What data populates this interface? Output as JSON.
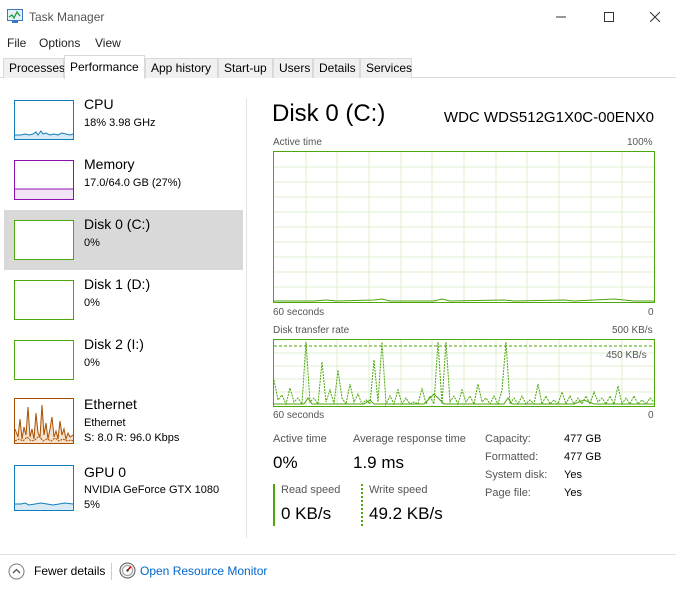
{
  "window": {
    "title": "Task Manager"
  },
  "menu": [
    "File",
    "Options",
    "View"
  ],
  "tabs": [
    "Processes",
    "Performance",
    "App history",
    "Start-up",
    "Users",
    "Details",
    "Services"
  ],
  "resources": [
    {
      "title": "CPU",
      "sub1": "18%  3.98 GHz",
      "color": "#117dbb"
    },
    {
      "title": "Memory",
      "sub1": "17.0/64.0 GB (27%)",
      "color": "#8b12ae"
    },
    {
      "title": "Disk 0 (C:)",
      "sub1": "0%",
      "color": "#4da60c"
    },
    {
      "title": "Disk 1 (D:)",
      "sub1": "0%",
      "color": "#4da60c"
    },
    {
      "title": "Disk 2 (I:)",
      "sub1": "0%",
      "color": "#4da60c"
    },
    {
      "title": "Ethernet",
      "sub1": "Ethernet",
      "sub2": "S: 8.0  R: 96.0 Kbps",
      "color": "#a74f01"
    },
    {
      "title": "GPU 0",
      "sub1": "NVIDIA GeForce GTX 1080",
      "sub2": "5%",
      "color": "#117dbb"
    }
  ],
  "detail": {
    "title": "Disk 0 (C:)",
    "model": "WDC WDS512G1X0C-00ENX0",
    "active_time_graph": {
      "label": "Active time",
      "max": "100%",
      "xlabel": "60 seconds",
      "min": "0"
    },
    "transfer_graph": {
      "label": "Disk transfer rate",
      "max": "500 KB/s",
      "ref": "450 KB/s",
      "xlabel": "60 seconds",
      "min": "0"
    },
    "stats": {
      "active_time_label": "Active time",
      "active_time": "0%",
      "avg_response_label": "Average response time",
      "avg_response": "1.9 ms",
      "read_label": "Read speed",
      "read": "0 KB/s",
      "write_label": "Write speed",
      "write": "49.2 KB/s"
    },
    "info": [
      {
        "label": "Capacity:",
        "value": "477 GB"
      },
      {
        "label": "Formatted:",
        "value": "477 GB"
      },
      {
        "label": "System disk:",
        "value": "Yes"
      },
      {
        "label": "Page file:",
        "value": "Yes"
      }
    ]
  },
  "footer": {
    "fewer": "Fewer details",
    "monitor": "Open Resource Monitor"
  },
  "colors": {
    "disk": "#4da60c",
    "link": "#0066cc",
    "selected": "#d9d9d9"
  }
}
